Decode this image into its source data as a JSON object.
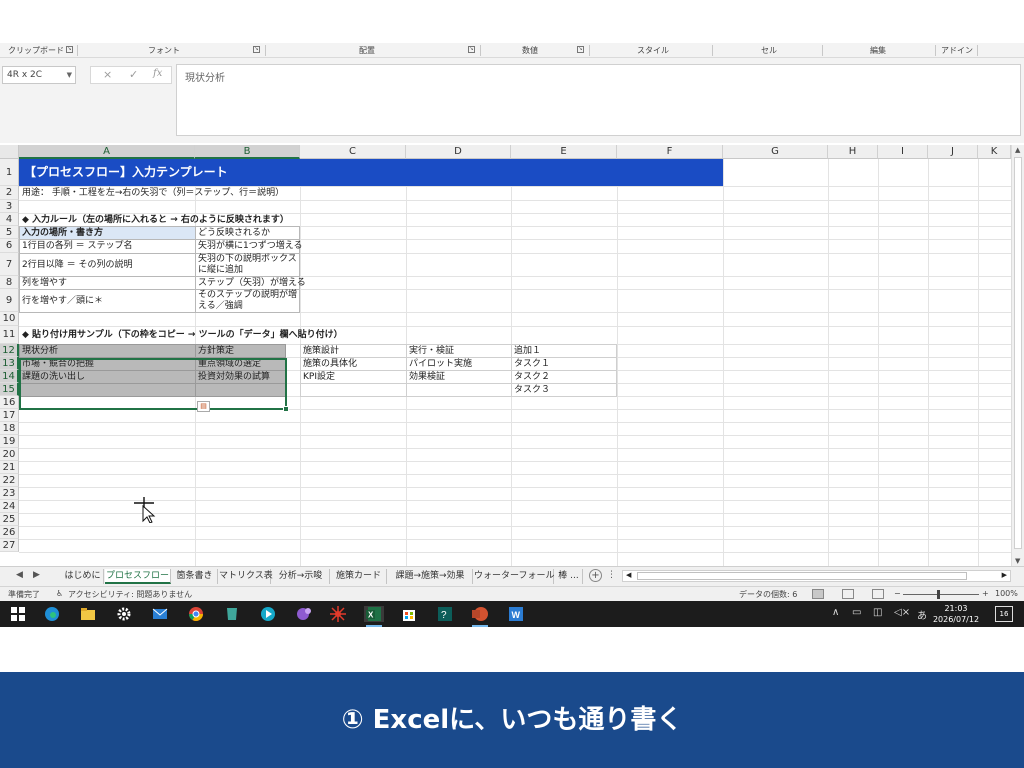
{
  "ribbon_groups": [
    "クリップボード",
    "フォント",
    "配置",
    "数値",
    "スタイル",
    "セル",
    "編集",
    "アドイン"
  ],
  "name_box": "4R x 2C",
  "formula_icons": [
    "×",
    "✓",
    "fx"
  ],
  "formula_value": "現状分析",
  "columns": [
    "A",
    "B",
    "C",
    "D",
    "E",
    "F",
    "G",
    "H",
    "I",
    "J",
    "K"
  ],
  "rows": [
    "1",
    "2",
    "3",
    "4",
    "5",
    "6",
    "7",
    "8",
    "9",
    "10",
    "11",
    "12",
    "13",
    "14",
    "15",
    "16",
    "17",
    "18",
    "19",
    "20",
    "21",
    "22",
    "23",
    "24",
    "25",
    "26",
    "27"
  ],
  "cells": {
    "title": "【プロセスフロー】入力テンプレート",
    "usage": "用途： 手順・工程を左→右の矢羽で（列＝ステップ、行＝説明）",
    "rules_heading": "◆ 入力ルール（左の場所に入れると → 右のように反映されます）",
    "rules_col_a": "入力の場所・書き方",
    "rules_col_b": "どう反映されるか",
    "rule1_a": "1行目の各列 ＝ ステップ名",
    "rule1_b": "矢羽が横に1つずつ増える",
    "rule2_a": "2行目以降 ＝ その列の説明",
    "rule2_b": "矢羽の下の説明ボックスに縦に追加",
    "rule3_a": "列を増やす",
    "rule3_b": "ステップ（矢羽）が増える",
    "rule4_a": "行を増やす／頭に＊",
    "rule4_b": "そのステップの説明が増える／強調",
    "sample_heading": "◆ 貼り付け用サンプル（下の枠をコピー → ツールの「データ」欄へ貼り付け）",
    "r12": [
      "現状分析",
      "方針策定",
      "施策設計",
      "実行・検証",
      "追加１"
    ],
    "r13": [
      "市場・競合の把握",
      "重点領域の選定",
      "施策の具体化",
      "パイロット実施",
      "タスク１"
    ],
    "r14": [
      "課題の洗い出し",
      "投資対効果の試算",
      "KPI設定",
      "効果検証",
      "タスク２"
    ],
    "r15": [
      "",
      "",
      "",
      "",
      "タスク３"
    ]
  },
  "sheet_tabs": [
    "はじめに",
    "プロセスフロー",
    "箇条書き",
    "マトリクス表",
    "分析→示唆",
    "施策カード",
    "課題→施策→効果",
    "ウォーターフォール",
    "棒 ..."
  ],
  "active_tab": "プロセスフロー",
  "status": {
    "ready": "準備完了",
    "accessibility": "アクセシビリティ: 問題ありません",
    "count": "データの個数: 6",
    "zoom": "100%"
  },
  "clock": {
    "time": "21:03",
    "date": "2026/07/12"
  },
  "ime": "あ",
  "notification_count": "16",
  "caption": "① Excelに、いつも通り書く",
  "colors": {
    "title_bar": "#1a4cc4",
    "selection": "#217346",
    "caption_bg": "#1a4a8c",
    "rules_header": "#dbe7f6"
  }
}
